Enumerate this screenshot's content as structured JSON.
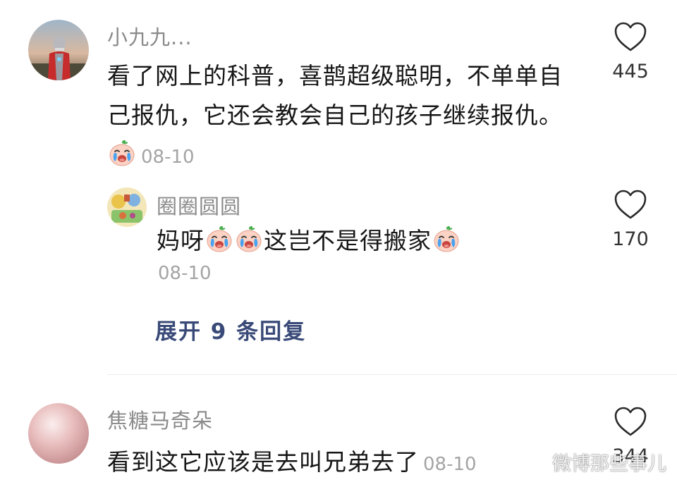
{
  "comments": [
    {
      "username": "小九九...",
      "text": "看了网上的科普，喜鹊超级聪明，不单单自己报仇，它还会教会自己的孩子继续报仇。",
      "date": "08-10",
      "likes": "445",
      "avatar": "avatar-ultraman"
    },
    {
      "username": "圈圈圆圆",
      "text_parts": [
        "妈呀",
        "这岂不是得搬家"
      ],
      "date": "08-10",
      "likes": "170",
      "avatar": "avatar-cartoon"
    },
    {
      "username": "焦糖马奇朵",
      "text": "看到这它应该是去叫兄弟去了",
      "date": "08-10",
      "likes": "344",
      "avatar": "avatar-pink-sphere"
    }
  ],
  "expand_replies": "展开 9 条回复",
  "watermark": "微博那些事儿",
  "icons": {
    "like": "heart-outline-icon",
    "emoji": "crying-face-icon",
    "watermark": "wechat-icon"
  },
  "colors": {
    "username": "#8a8a8a",
    "date": "#a4a4a4",
    "expand": "#3a4a78",
    "text": "#161616"
  }
}
